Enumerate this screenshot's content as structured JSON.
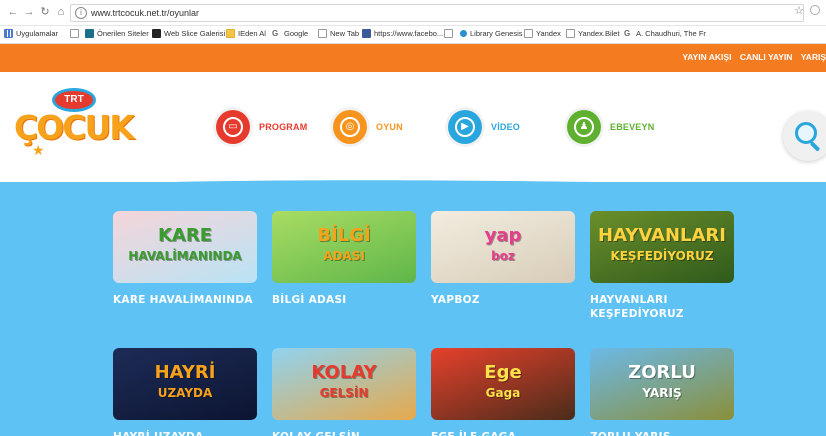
{
  "browser": {
    "url": "www.trtcocuk.net.tr/oyunlar",
    "bookmarks": [
      {
        "label": "Uygulamalar",
        "icon": "grid"
      },
      {
        "label": "",
        "icon": "page"
      },
      {
        "label": "Önerilen Siteler",
        "icon": "teal"
      },
      {
        "label": "Web Slice Galerisi",
        "icon": "dark"
      },
      {
        "label": "IEden Al",
        "icon": "yellow"
      },
      {
        "label": "Google",
        "icon": "g"
      },
      {
        "label": "New Tab",
        "icon": "page"
      },
      {
        "label": "https://www.facebo...",
        "icon": "blue"
      },
      {
        "label": "",
        "icon": "page"
      },
      {
        "label": "Library Genesis",
        "icon": "dot"
      },
      {
        "label": "Yandex",
        "icon": "page"
      },
      {
        "label": "Yandex.Bilet",
        "icon": "page"
      },
      {
        "label": "A. Chaudhuri, The Fr",
        "icon": "g"
      }
    ]
  },
  "topbar": {
    "links": [
      "YAYIN AKIŞI",
      "CANLI YAYIN",
      "YARIŞ"
    ],
    "color": "#f47b20"
  },
  "logo": {
    "trt": "TRT",
    "word": "ÇOCUK"
  },
  "menu": [
    {
      "label": "PROGRAM",
      "color": "#e73a2e",
      "icon": "tv-icon",
      "glyph": "▭"
    },
    {
      "label": "OYUN",
      "color": "#f7941d",
      "icon": "gamepad-icon",
      "glyph": "◎"
    },
    {
      "label": "VİDEO",
      "color": "#2aa6de",
      "icon": "video-icon",
      "glyph": "▶"
    },
    {
      "label": "EBEVEYN",
      "color": "#5fb030",
      "icon": "family-icon",
      "glyph": "♟"
    }
  ],
  "search": {
    "icon": "search-icon"
  },
  "games": [
    {
      "title": "KARE HAVALİMANINDA",
      "thumb_text": "KARE",
      "thumb_sub": "HAVALİMANINDA",
      "bg1": "#f5d5d9",
      "bg2": "#b9e3f5",
      "text_color": "#3a9b2f"
    },
    {
      "title": "BİLGİ ADASI",
      "thumb_text": "BİLGİ",
      "thumb_sub": "ADASI",
      "bg1": "#a9dd63",
      "bg2": "#5fb64a",
      "text_color": "#f7a21b"
    },
    {
      "title": "YAPBOZ",
      "thumb_text": "yap",
      "thumb_sub": "boz",
      "bg1": "#f2ede0",
      "bg2": "#d8ccb8",
      "text_color": "#e63d8c"
    },
    {
      "title": "HAYVANLARI KEŞFEDİYORUZ",
      "thumb_text": "HAYVANLARI",
      "thumb_sub": "KEŞFEDİYORUZ",
      "bg1": "#6a8f2a",
      "bg2": "#2f5a1c",
      "text_color": "#ffd23f"
    },
    {
      "title": "HAYRİ UZAYDA",
      "thumb_text": "HAYRİ",
      "thumb_sub": "UZAYDA",
      "bg1": "#1d2c57",
      "bg2": "#0c1431",
      "text_color": "#f7a21b"
    },
    {
      "title": "KOLAY GELSİN",
      "thumb_text": "KOLAY",
      "thumb_sub": "GELSİN",
      "bg1": "#8fd3f0",
      "bg2": "#e6a94c",
      "text_color": "#e73a2e"
    },
    {
      "title": "EGE İLE GAGA",
      "thumb_text": "Ege",
      "thumb_sub": "Gaga",
      "bg1": "#e6412c",
      "bg2": "#4a2c1a",
      "text_color": "#ffe24a"
    },
    {
      "title": "ZORLU YARIŞ",
      "thumb_text": "ZORLU",
      "thumb_sub": "YARIŞ",
      "bg1": "#6cb9e8",
      "bg2": "#8a8f3a",
      "text_color": "#ffffff"
    }
  ]
}
